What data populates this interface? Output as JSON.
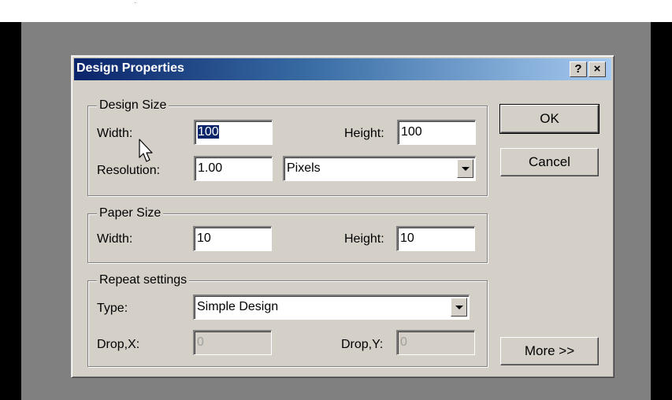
{
  "dialog": {
    "title": "Design Properties",
    "help_label": "?",
    "close_label": "×"
  },
  "design_size": {
    "legend": "Design Size",
    "width_label": "Width:",
    "width_value": "100",
    "height_label": "Height:",
    "height_value": "100",
    "resolution_label": "Resolution:",
    "resolution_value": "1.00",
    "units_selected": "Pixels"
  },
  "paper_size": {
    "legend": "Paper Size",
    "width_label": "Width:",
    "width_value": "10",
    "height_label": "Height:",
    "height_value": "10"
  },
  "repeat_settings": {
    "legend": "Repeat settings",
    "type_label": "Type:",
    "type_selected": "Simple Design",
    "dropx_label": "Drop,X:",
    "dropx_value": "0",
    "dropy_label": "Drop,Y:",
    "dropy_value": "0"
  },
  "buttons": {
    "ok": "OK",
    "cancel": "Cancel",
    "more": "More >>"
  },
  "icons": {
    "cursor": "mouse-pointer-icon",
    "dropdown": "chevron-down-icon"
  },
  "colors": {
    "title_start": "#0a246a",
    "title_end": "#a6caf0",
    "face": "#d4d0c8",
    "desktop": "#808080"
  }
}
